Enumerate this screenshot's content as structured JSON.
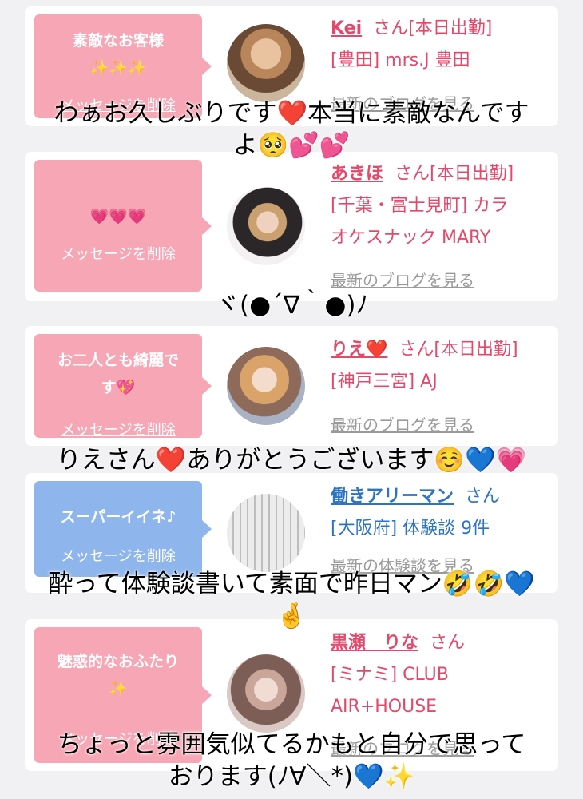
{
  "cards": [
    {
      "message": "素敵なお客様",
      "deco": "✨✨✨",
      "delete_label": "メッセージを削除",
      "name": "Kei",
      "san": "さん[本日出勤]",
      "sub_line1": "[豊田] mrs.J 豊田",
      "sub_line2": "",
      "link": "最新のブログを見る"
    },
    {
      "message": "",
      "deco": "💗💗💗",
      "delete_label": "メッセージを削除",
      "name": "あきほ",
      "san": "さん[本日出勤]",
      "sub_line1": "[千葉・富士見町] カラ",
      "sub_line2": "オケスナック MARY",
      "link": "最新のブログを見る"
    },
    {
      "message": "お二人とも綺麗で",
      "deco": "す💖",
      "delete_label": "メッセージを削除",
      "name": "りえ❤️",
      "san": "さん[本日出勤]",
      "sub_line1": "[神戸三宮] AJ",
      "sub_line2": "",
      "link": "最新のブログを見る"
    },
    {
      "message": "スーパーイイネ♪",
      "deco": "",
      "delete_label": "メッセージを削除",
      "name": "働きアリーマン",
      "san": "さん",
      "sub_line1": "[大阪府] 体験談 9件",
      "sub_line2": "",
      "link": "最新の体験談を見る"
    },
    {
      "message": "魅惑的なおふたり",
      "deco": "✨",
      "delete_label": "メッセージを削除",
      "name": "黒瀬　りな",
      "san": "さん",
      "sub_line1": "[ミナミ] CLUB",
      "sub_line2": "AIR+HOUSE",
      "link": "最新のブログを見る"
    }
  ],
  "captions": {
    "c1_line1": "わぁお久しぶりです❤️本当に素敵なんです",
    "c1_line2": "よ🥺💕💕",
    "c2_line1": "ヾ(●´∇｀●)ﾉ",
    "c3_line1": "りえさん❤️ありがとうございます☺️💙💗",
    "c4_line1": "酔って体験談書いて素面で昨日マン🤣🤣💙",
    "c4_line2": "🤞",
    "c5_line1": "ちょっと雰囲気似てるかもと自分で思って",
    "c5_line2": "おります(ﾉ∀＼*)💙✨"
  },
  "colors": {
    "pink_bubble": "#f6a6b4",
    "blue_bubble": "#8fb6ec",
    "pink_text": "#e2496a",
    "blue_text": "#2d74c1",
    "link_gray": "#9a9a9a"
  }
}
